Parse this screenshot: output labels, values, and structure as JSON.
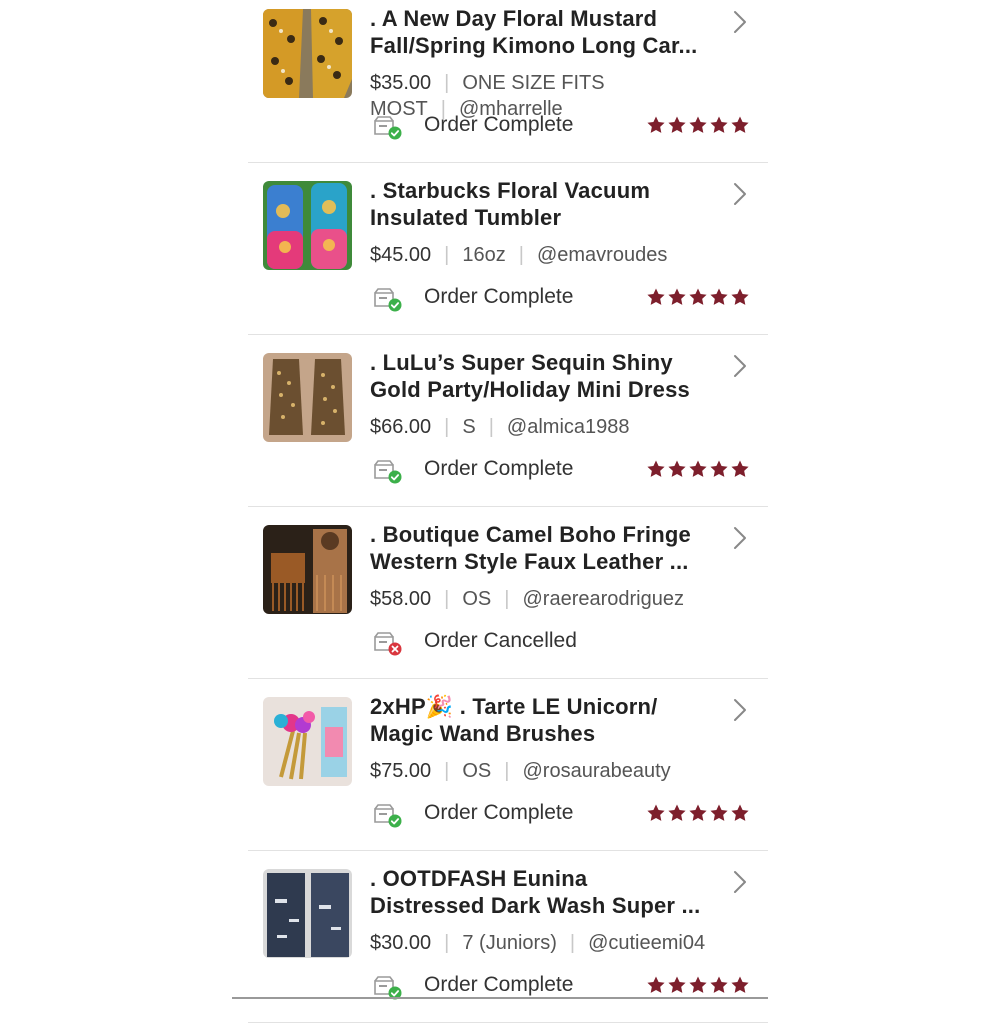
{
  "orders": [
    {
      "title_line1": ". A New Day Floral Mustard",
      "title_line2": "Fall/Spring Kimono Long Car...",
      "price": "$35.00",
      "size": "ONE SIZE FITS MOST",
      "seller": "@mharrelle",
      "status": "Order Complete",
      "status_type": "complete",
      "rating": 5,
      "thumb": "mustard-floral-kimono"
    },
    {
      "title_line1": ". Starbucks Floral Vacuum",
      "title_line2": "Insulated Tumbler",
      "price": "$45.00",
      "size": "16oz",
      "seller": "@emavroudes",
      "status": "Order Complete",
      "status_type": "complete",
      "rating": 5,
      "thumb": "floral-tumblers"
    },
    {
      "title_line1": ". LuLu’s Super Sequin Shiny",
      "title_line2": "Gold Party/Holiday Mini Dress",
      "price": "$66.00",
      "size": "S",
      "seller": "@almica1988",
      "status": "Order Complete",
      "status_type": "complete",
      "rating": 5,
      "thumb": "gold-sequin-dress"
    },
    {
      "title_line1": ". Boutique Camel Boho Fringe",
      "title_line2": "Western Style Faux Leather ...",
      "price": "$58.00",
      "size": "OS",
      "seller": "@raerearodriguez",
      "status": "Order Cancelled",
      "status_type": "cancelled",
      "rating": 0,
      "thumb": "camel-fringe-bag"
    },
    {
      "title_line1": "2xHP🎉 . Tarte LE Unicorn/",
      "title_line2": "Magic Wand Brushes",
      "price": "$75.00",
      "size": "OS",
      "seller": "@rosaurabeauty",
      "status": "Order Complete",
      "status_type": "complete",
      "rating": 5,
      "thumb": "unicorn-brushes"
    },
    {
      "title_line1": ". OOTDFASH Eunina",
      "title_line2": "Distressed Dark Wash Super ...",
      "price": "$30.00",
      "size": "7 (Juniors)",
      "seller": "@cutieemi04",
      "status": "Order Complete",
      "status_type": "complete",
      "rating": 5,
      "thumb": "distressed-jeans"
    }
  ],
  "colors": {
    "star": "#7d1f2c",
    "complete_badge": "#3cb04a",
    "cancelled_badge": "#d9363e"
  }
}
